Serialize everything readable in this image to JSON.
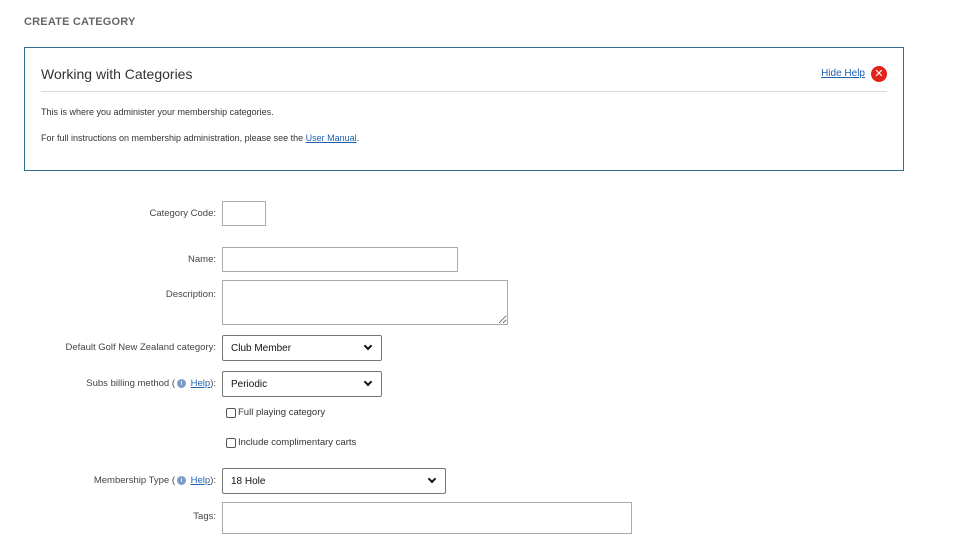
{
  "page_title": "CREATE CATEGORY",
  "help": {
    "title": "Working with Categories",
    "hide_label": "Hide Help",
    "line1": "This is where you administer your membership categories.",
    "line2_prefix": "For full instructions on membership administration, please see the ",
    "line2_link": "User Manual",
    "line2_suffix": "."
  },
  "form": {
    "category_code_label": "Category Code:",
    "category_code_value": "",
    "name_label": "Name:",
    "name_value": "",
    "description_label": "Description:",
    "description_value": "",
    "gnz_label": "Default Golf New Zealand category:",
    "gnz_value": "Club Member",
    "subs_label_prefix": "Subs billing method (",
    "subs_help": "Help",
    "subs_label_suffix": "):",
    "subs_value": "Periodic",
    "full_playing_label": "Full playing category",
    "comp_carts_label": "Include complimentary carts",
    "membership_type_prefix": "Membership Type (",
    "membership_type_help": "Help",
    "membership_type_suffix": "):",
    "membership_type_value": "18 Hole",
    "tags_label": "Tags:",
    "tags_value": ""
  },
  "icons": {
    "close": "close-icon",
    "info": "info-icon",
    "dropdown": "chevron-down-icon"
  },
  "colors": {
    "link": "#1f5fae",
    "help_border": "#2f6e8e",
    "close": "#e2231a"
  }
}
